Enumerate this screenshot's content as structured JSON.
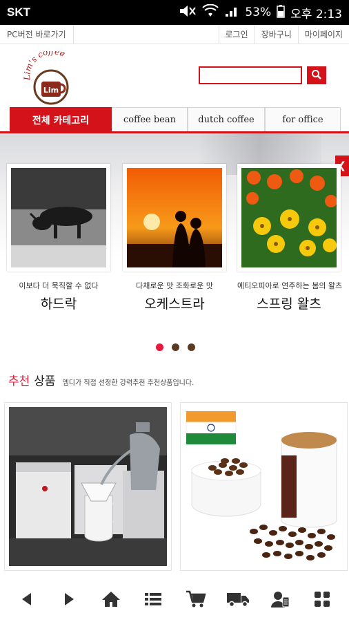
{
  "status": {
    "carrier": "SKT",
    "battery": "53%",
    "time": "오후 2:13"
  },
  "top_links": {
    "pc_version": "PC버전 바로가기",
    "login": "로그인",
    "cart": "장바구니",
    "mypage": "마이페이지"
  },
  "logo": {
    "text": "Lim's coffee"
  },
  "search": {
    "placeholder": "",
    "value": ""
  },
  "tabs": [
    {
      "label": "전체 카테고리",
      "active": true
    },
    {
      "label": "coffee bean"
    },
    {
      "label": "dutch coffee"
    },
    {
      "label": "for office"
    }
  ],
  "banner": {
    "prev_icon": "chevron-left-icon",
    "items": [
      {
        "subtitle": "이보다 더 묵직할 수 없다",
        "name": "하드락"
      },
      {
        "subtitle": "다채로운 맛 조화로운 맛",
        "name": "오케스트라"
      },
      {
        "subtitle": "에티오피아로 연주하는 봄의 왈츠",
        "name": "스프링 왈츠"
      }
    ]
  },
  "pagination": {
    "count": 3,
    "active_index": 0
  },
  "recommended": {
    "title_red": "추천",
    "title_black": "상품",
    "description": "엠디가 직접 선정한 강력추천 추천상품입니다."
  },
  "bottom_nav": [
    {
      "icon": "back-arrow-icon"
    },
    {
      "icon": "forward-arrow-icon"
    },
    {
      "icon": "home-icon"
    },
    {
      "icon": "list-icon"
    },
    {
      "icon": "cart-icon"
    },
    {
      "icon": "delivery-truck-icon"
    },
    {
      "icon": "my-account-icon"
    },
    {
      "icon": "grid-menu-icon"
    }
  ],
  "colors": {
    "accent": "#d4121a",
    "dot_active": "#e8193a",
    "dot_inactive": "#5a3a22"
  }
}
